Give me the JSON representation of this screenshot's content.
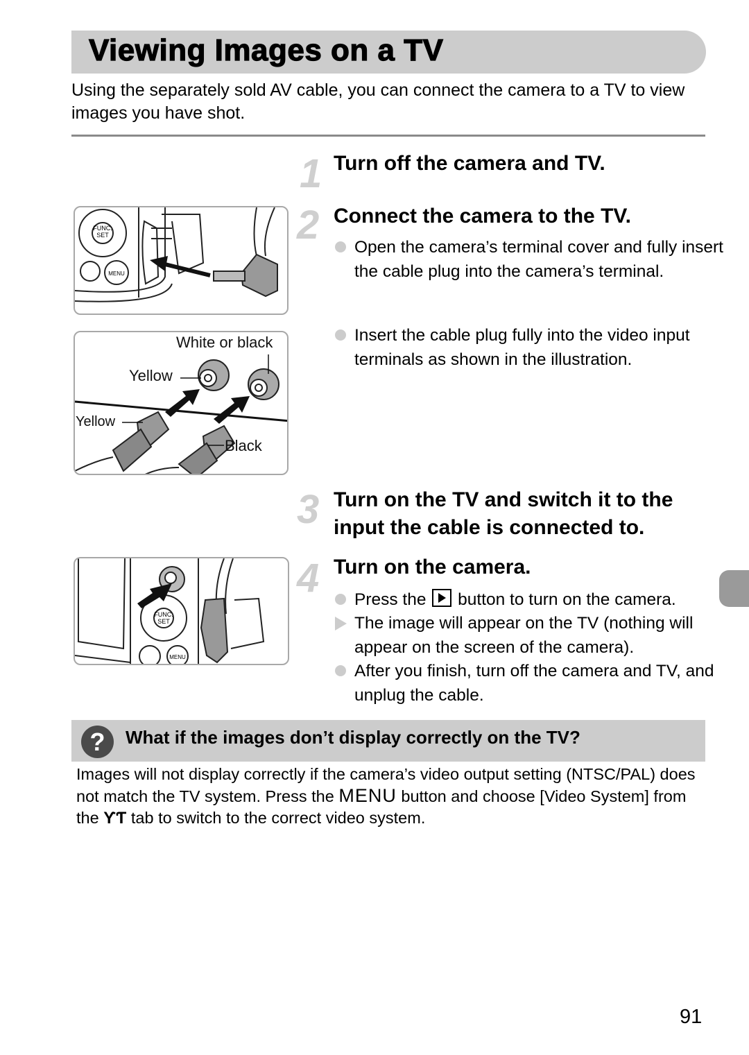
{
  "page": {
    "title": "Viewing Images on a TV",
    "intro": "Using the separately sold AV cable, you can connect the camera to a TV to view images you have shot.",
    "page_number": "91"
  },
  "steps": [
    {
      "number": "1",
      "title": "Turn off the camera and TV."
    },
    {
      "number": "2",
      "title": "Connect the camera to the TV.",
      "bullets": [
        {
          "type": "dot",
          "text": "Open the camera’s terminal cover and fully insert the cable plug into the camera’s terminal."
        },
        {
          "type": "dot",
          "text": "Insert the cable plug fully into the video input terminals as shown in the illustration."
        }
      ]
    },
    {
      "number": "3",
      "title": "Turn on the TV and switch it to the input the cable is connected to."
    },
    {
      "number": "4",
      "title": "Turn on the camera.",
      "bullets": [
        {
          "type": "dot",
          "text_before": "Press the",
          "icon": "playback-button-icon",
          "text_after": "button to turn on the camera."
        },
        {
          "type": "triangle",
          "text": "The image will appear on the TV (nothing will appear on the screen of the camera)."
        },
        {
          "type": "dot",
          "text": "After you finish, turn off the camera and TV, and unplug the cable."
        }
      ]
    }
  ],
  "illustrations": {
    "camera_terminal": {
      "labels": {
        "func": "FUNC.",
        "set": "SET",
        "menu": "MENU"
      }
    },
    "av_plugs": {
      "labels": {
        "white_or_black": "White or black",
        "yellow_top": "Yellow",
        "yellow_left": "Yellow",
        "black": "Black"
      }
    },
    "playback_button": {
      "labels": {
        "func": "FUNC.",
        "set": "SET",
        "menu": "MENU"
      }
    }
  },
  "faq": {
    "icon": "question-icon",
    "title": "What if the images don’t display correctly on the TV?",
    "body_part1": "Images will not display correctly if the camera’s video output setting (NTSC/PAL) does not match the TV system. Press the",
    "menu_word": "MENU",
    "body_part2": "button and choose [Video System] from the",
    "tab_icon": "ƳƬ",
    "body_part3": "tab to switch to the correct video system."
  }
}
